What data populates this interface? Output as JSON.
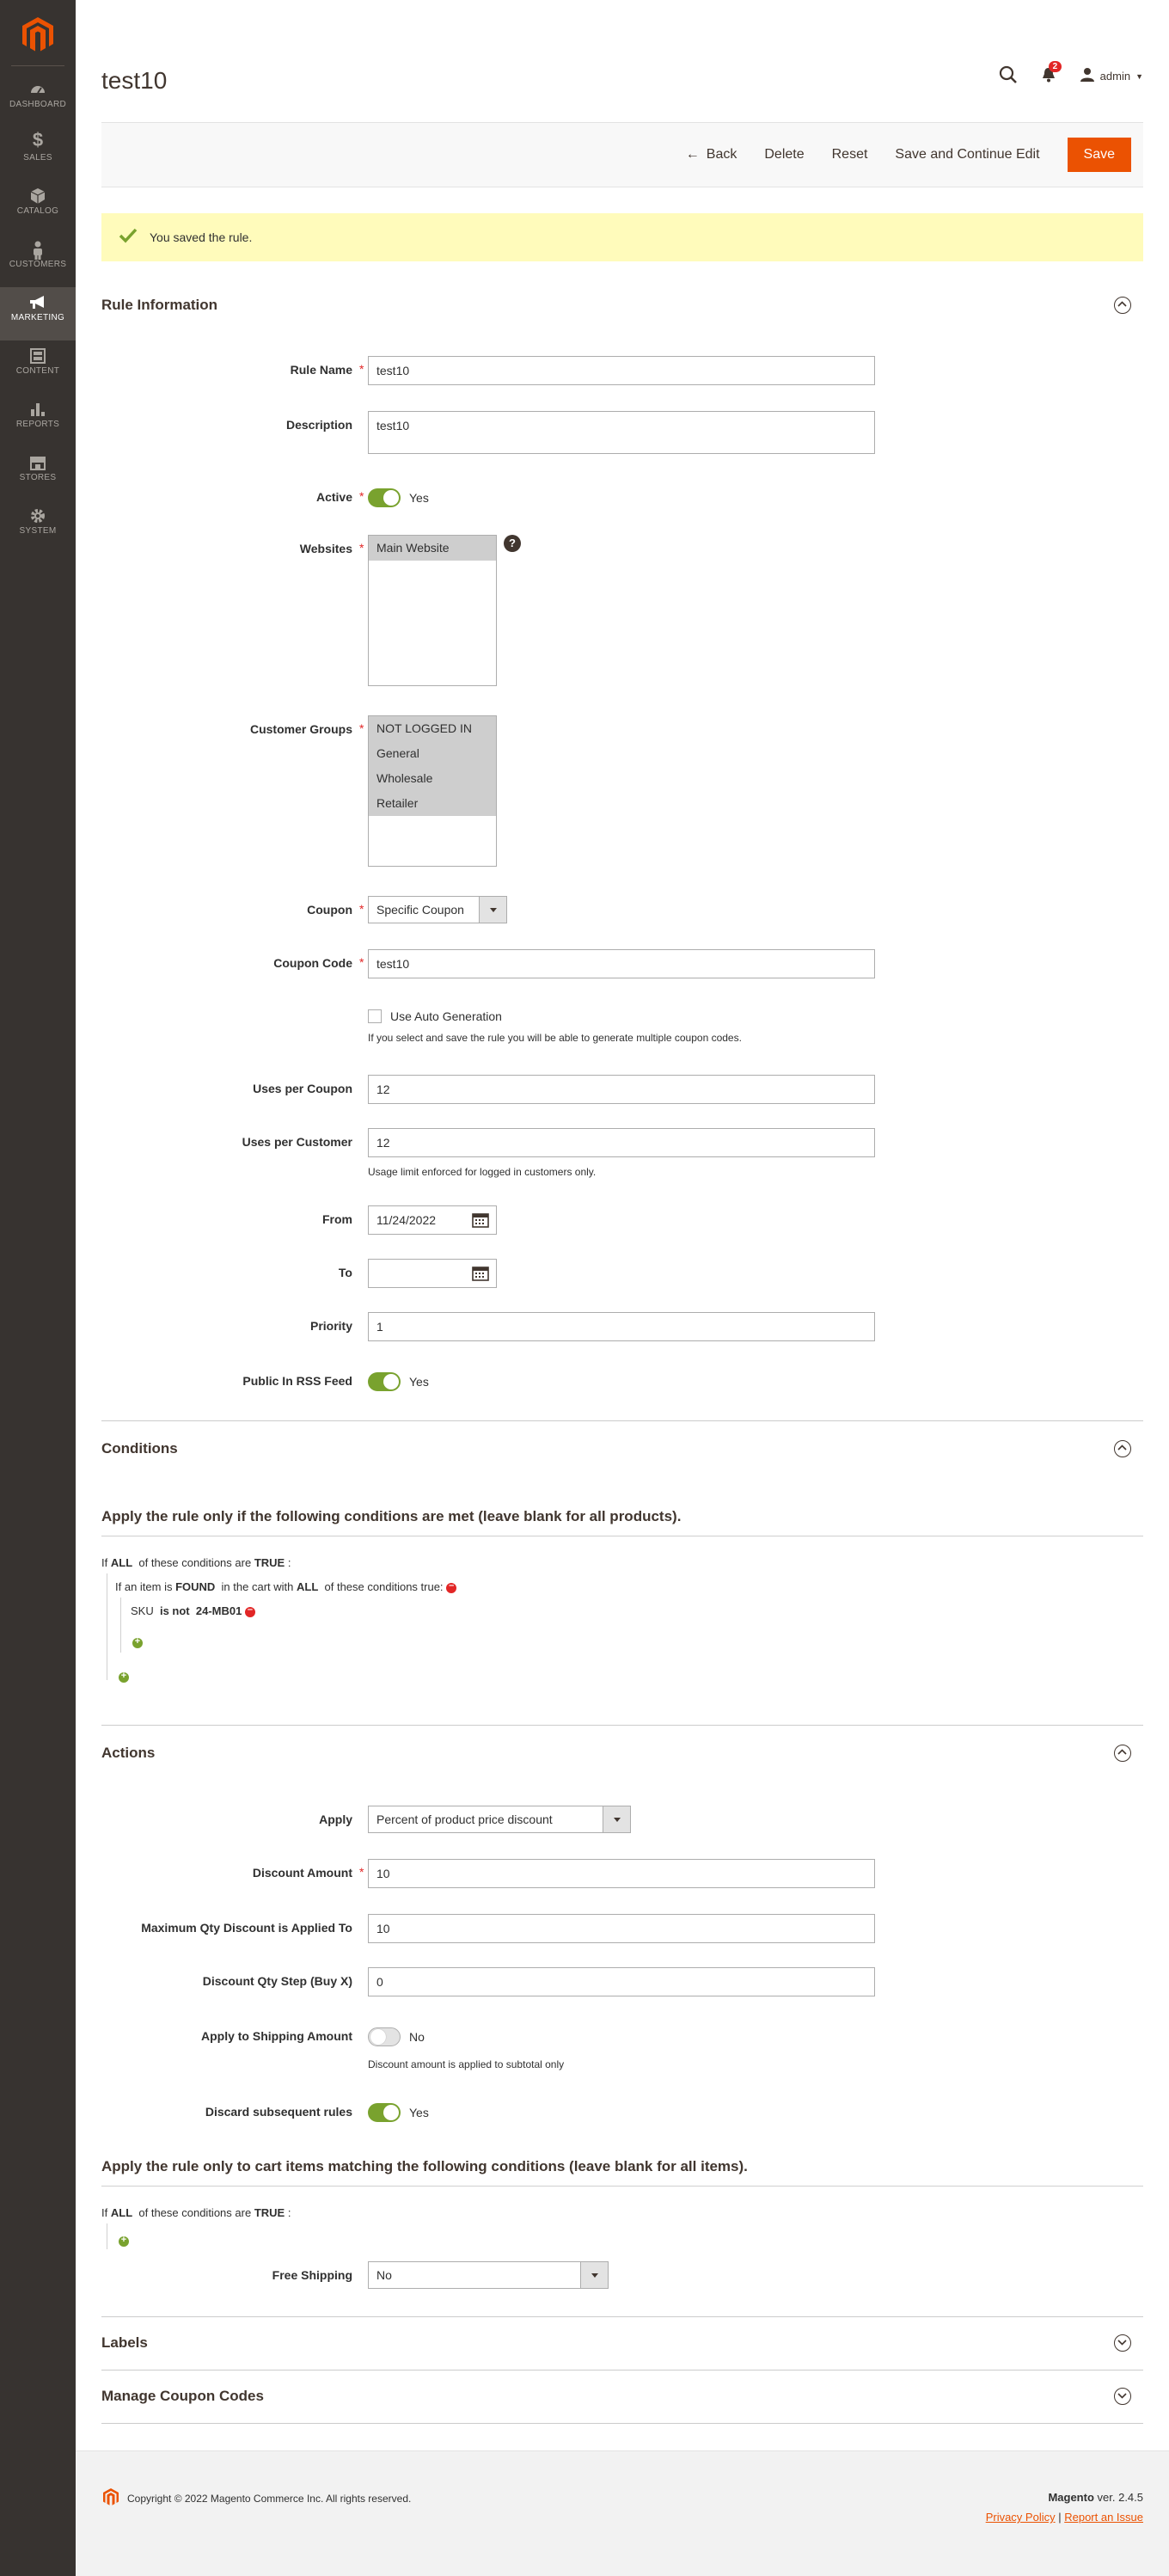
{
  "sidebar": {
    "items": [
      {
        "label": "DASHBOARD",
        "icon": "dashboard-icon"
      },
      {
        "label": "SALES",
        "icon": "dollar-icon"
      },
      {
        "label": "CATALOG",
        "icon": "cube-icon"
      },
      {
        "label": "CUSTOMERS",
        "icon": "person-icon"
      },
      {
        "label": "MARKETING",
        "icon": "megaphone-icon"
      },
      {
        "label": "CONTENT",
        "icon": "layout-icon"
      },
      {
        "label": "REPORTS",
        "icon": "bar-chart-icon"
      },
      {
        "label": "STORES",
        "icon": "store-icon"
      },
      {
        "label": "SYSTEM",
        "icon": "gear-icon"
      }
    ]
  },
  "header": {
    "title": "test10",
    "notifications": "2",
    "user": "admin"
  },
  "toolbar": {
    "back": "Back",
    "delete": "Delete",
    "reset": "Reset",
    "save_continue": "Save and Continue Edit",
    "save": "Save"
  },
  "message": "You saved the rule.",
  "rule_info": {
    "title": "Rule Information",
    "rule_name_label": "Rule Name",
    "rule_name": "test10",
    "description_label": "Description",
    "description": "test10",
    "active_label": "Active",
    "active_value": "Yes",
    "websites_label": "Websites",
    "websites": [
      "Main Website"
    ],
    "groups_label": "Customer Groups",
    "groups": [
      "NOT LOGGED IN",
      "General",
      "Wholesale",
      "Retailer"
    ],
    "coupon_label": "Coupon",
    "coupon": "Specific Coupon",
    "coupon_code_label": "Coupon Code",
    "coupon_code": "test10",
    "auto_gen_label": "Use Auto Generation",
    "auto_gen_note": "If you select and save the rule you will be able to generate multiple coupon codes.",
    "uses_coupon_label": "Uses per Coupon",
    "uses_coupon": "12",
    "uses_customer_label": "Uses per Customer",
    "uses_customer": "12",
    "uses_customer_note": "Usage limit enforced for logged in customers only.",
    "from_label": "From",
    "from": "11/24/2022",
    "to_label": "To",
    "to": "",
    "priority_label": "Priority",
    "priority": "1",
    "rss_label": "Public In RSS Feed",
    "rss_value": "Yes"
  },
  "conditions": {
    "title": "Conditions",
    "subtitle": "Apply the rule only if the following conditions are met (leave blank for all products).",
    "if": "If",
    "all": "ALL",
    "of_these": "of these conditions are",
    "true_word": "TRUE",
    "item_line_a": "If an item is",
    "found": "FOUND",
    "item_line_b": "in the cart with",
    "item_line_c": "of these conditions true:",
    "sku": "SKU",
    "is_not": "is not",
    "sku_value": "24-MB01"
  },
  "actions": {
    "title": "Actions",
    "apply_label": "Apply",
    "apply": "Percent of product price discount",
    "discount_label": "Discount Amount",
    "discount": "10",
    "max_qty_label": "Maximum Qty Discount is Applied To",
    "max_qty": "10",
    "qty_step_label": "Discount Qty Step (Buy X)",
    "qty_step": "0",
    "shipping_label": "Apply to Shipping Amount",
    "shipping_value": "No",
    "shipping_note": "Discount amount is applied to subtotal only",
    "discard_label": "Discard subsequent rules",
    "discard_value": "Yes",
    "subtitle": "Apply the rule only to cart items matching the following conditions (leave blank for all items).",
    "free_shipping_label": "Free Shipping",
    "free_shipping": "No"
  },
  "labels_title": "Labels",
  "coupons_title": "Manage Coupon Codes",
  "footer": {
    "copyright": "Copyright © 2022 Magento Commerce Inc. All rights reserved.",
    "brand": "Magento",
    "version": " ver. 2.4.5",
    "privacy": "Privacy Policy",
    "report": "Report an Issue"
  },
  "colors": {
    "accent": "#eb5202",
    "sidebar": "#373330",
    "success": "#79a22e",
    "message_bg": "#fffbbb"
  }
}
